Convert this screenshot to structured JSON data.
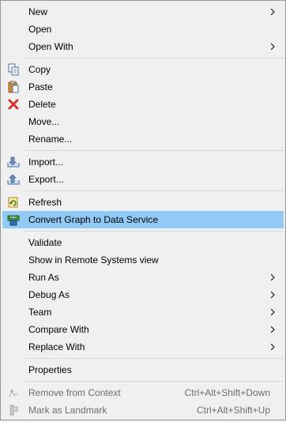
{
  "menu": {
    "new": {
      "label": "New",
      "icon": "none",
      "submenu": true
    },
    "open": {
      "label": "Open"
    },
    "open_with": {
      "label": "Open With",
      "submenu": true
    },
    "copy": {
      "label": "Copy",
      "icon": "copy-icon"
    },
    "paste": {
      "label": "Paste",
      "icon": "paste-icon"
    },
    "delete": {
      "label": "Delete",
      "icon": "delete-icon",
      "icon_color": "#d9342b"
    },
    "move": {
      "label": "Move..."
    },
    "rename": {
      "label": "Rename..."
    },
    "import": {
      "label": "Import...",
      "icon": "import-icon"
    },
    "export": {
      "label": "Export...",
      "icon": "export-icon"
    },
    "refresh": {
      "label": "Refresh",
      "icon": "refresh-icon"
    },
    "convert_graph": {
      "label": "Convert Graph to Data Service",
      "icon": "data-service-icon",
      "highlighted": true,
      "highlight_color": "#91c9f7"
    },
    "validate": {
      "label": "Validate"
    },
    "show_remote": {
      "label": "Show in Remote Systems view"
    },
    "run_as": {
      "label": "Run As",
      "submenu": true
    },
    "debug_as": {
      "label": "Debug As",
      "submenu": true
    },
    "team": {
      "label": "Team",
      "submenu": true
    },
    "compare_with": {
      "label": "Compare With",
      "submenu": true
    },
    "replace_with": {
      "label": "Replace With",
      "submenu": true
    },
    "properties": {
      "label": "Properties"
    },
    "remove_context": {
      "label": "Remove from Context",
      "shortcut": "Ctrl+Alt+Shift+Down",
      "disabled": true,
      "icon": "remove-context-icon"
    },
    "mark_landmark": {
      "label": "Mark as Landmark",
      "shortcut": "Ctrl+Alt+Shift+Up",
      "disabled": true,
      "icon": "landmark-icon"
    }
  }
}
